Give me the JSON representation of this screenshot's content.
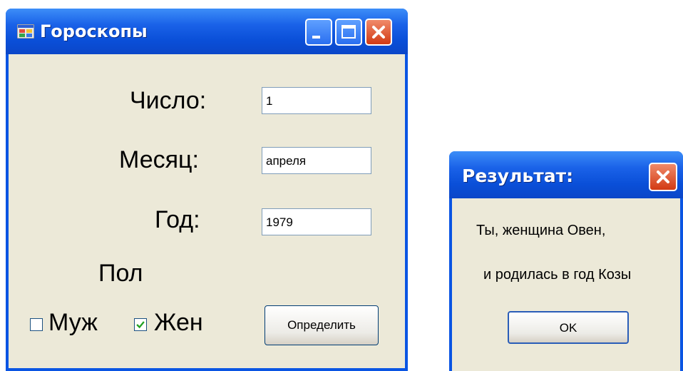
{
  "main_window": {
    "title": "Гороскопы",
    "icon": "app-icon",
    "controls": {
      "minimize": "minimize-icon",
      "maximize": "maximize-icon",
      "close": "close-icon"
    },
    "form": {
      "day_label": "Число:",
      "day_value": "1",
      "month_label": "Месяц:",
      "month_value": "апреля",
      "year_label": "Год:",
      "year_value": "1979",
      "gender_label": "Пол",
      "male_label": "Муж",
      "male_checked": false,
      "female_label": "Жен",
      "female_checked": true,
      "submit_label": "Определить"
    }
  },
  "result_dialog": {
    "title": "Результат:",
    "line1": "Ты, женщина Овен,",
    "line2": "и родилась в год Козы",
    "ok_label": "OK"
  },
  "colors": {
    "titlebar": "#0a55e3",
    "client": "#ece9d8",
    "close_button": "#d23a14",
    "checkmark": "#21a121"
  }
}
